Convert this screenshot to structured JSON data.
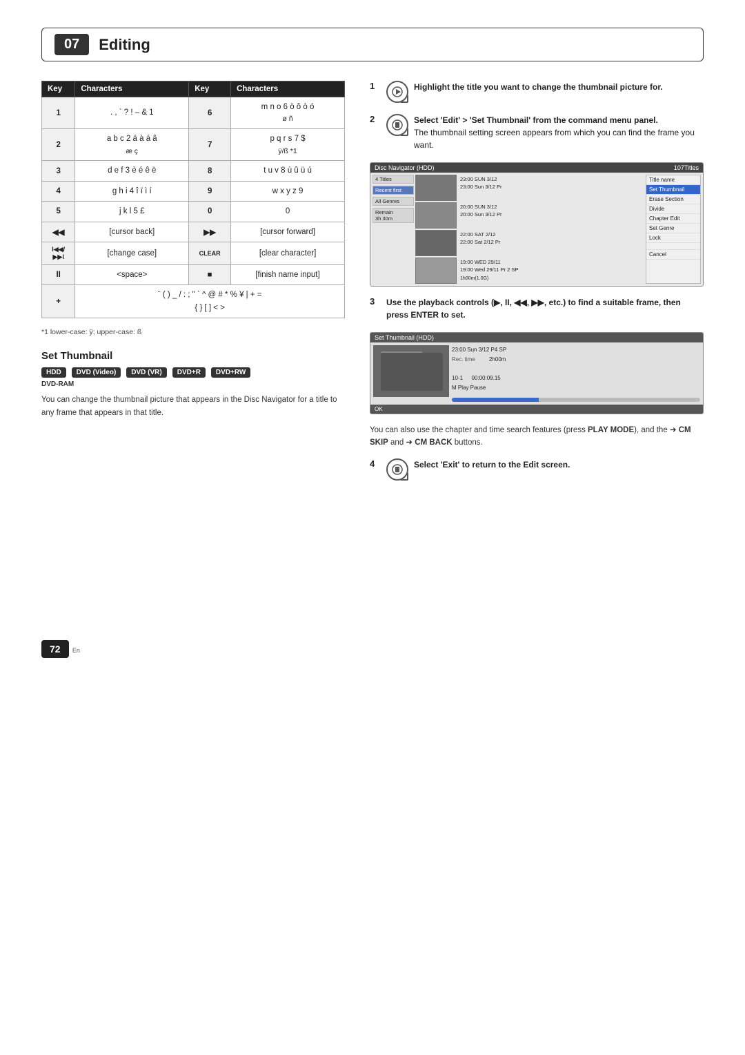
{
  "chapter": {
    "number": "07",
    "title": "Editing"
  },
  "char_table": {
    "headers": [
      "Key",
      "Characters",
      "Key",
      "Characters"
    ],
    "rows": [
      {
        "key1": "1",
        "chars1": ".,`?!–&1",
        "key2": "6",
        "chars2": "m n o 6 ö ô ò ó\nø ñ"
      },
      {
        "key1": "2",
        "chars1": "a b c 2 ä à á â\næ ç",
        "key2": "7",
        "chars2": "p q r s 7 $\nÿ/ß *1"
      },
      {
        "key1": "3",
        "chars1": "d e f 3 è é ê ë",
        "key2": "8",
        "chars2": "t u v 8 ù û ü ú"
      },
      {
        "key1": "4",
        "chars1": "g h i 4 î ï ì í",
        "key2": "9",
        "chars2": "w x y z 9"
      },
      {
        "key1": "5",
        "chars1": "j k l 5 £",
        "key2": "0",
        "chars2": "0"
      },
      {
        "key1": "◀◀",
        "chars1": "[cursor back]",
        "key2": "▶▶",
        "chars2": "[cursor forward]"
      },
      {
        "key1": "I◀◀/\n▶▶I",
        "chars1": "[change case]",
        "key2": "CLEAR",
        "chars2": "[clear character]"
      },
      {
        "key1": "II",
        "chars1": "<space>",
        "key2": "■",
        "chars2": "[finish name input]"
      },
      {
        "key1": "+",
        "chars1": "¨ ( ) _ / : ; \" ` ^ @ # * % ¥ | + =\n{ } [ ] < >",
        "key2": "",
        "chars2": ""
      }
    ]
  },
  "footnote": "*1  lower-case: ÿ; upper-case: ß",
  "set_thumbnail": {
    "title": "Set Thumbnail",
    "formats_hdd": "HDD",
    "formats_dvd_video": "DVD (Video)",
    "formats_dvd_vr": "DVD (VR)",
    "formats_dvdplus_r": "DVD+R",
    "formats_dvdplus_rw": "DVD+RW",
    "formats_dvd_ram": "DVD-RAM",
    "body_text": "You can change the thumbnail picture that appears in the Disc Navigator for a title to any frame that appears in that title."
  },
  "steps": {
    "step1": {
      "number": "1",
      "text_bold": "Highlight the title you want to change the thumbnail picture for."
    },
    "step2": {
      "number": "2",
      "text_bold": "Select 'Edit' > 'Set Thumbnail' from the command menu panel.",
      "subtext": "The thumbnail setting screen appears from which you can find the frame you want."
    },
    "step3": {
      "number": "3",
      "text_bold": "Use the playback controls (▶, II, ◀◀, ▶▶, etc.) to find a suitable frame, then press ENTER to set."
    },
    "step3_subtext": "You can also use the chapter and time search features (press PLAY MODE), and the ➜ CM SKIP and ➜ CM BACK buttons.",
    "step4": {
      "number": "4",
      "text_bold": "Select 'Exit' to return to the Edit screen."
    }
  },
  "nav_screen": {
    "title": "Disc Navigator (HDD)",
    "title_count": "107Titles",
    "sidebar_items": [
      "4 Titles",
      "Recent first",
      "All Genres",
      "Remain\n3h 30m"
    ],
    "rows": [
      {
        "time": "23:00 SUN 3/12",
        "time2": "23:00 Sun 3/12 Pr",
        "label": ""
      },
      {
        "time": "20:00 SUN 3/12",
        "time2": "20:00 Sun 3/12 Pr",
        "label": ""
      },
      {
        "time": "22:00 SAT 2/12",
        "time2": "22:00 Sat 2/12 Pr",
        "label": ""
      },
      {
        "time": "19:00 WED 29/11",
        "time2": "19:00 Wed 29/11 Pr 2 SP",
        "extra": "1h00m(1.0G)"
      }
    ],
    "menu_items": [
      "Title name",
      "Set Thumbnail",
      "Erase Section",
      "Divide",
      "Chapter Edit",
      "Set Genre",
      "Lock",
      "",
      "Cancel"
    ]
  },
  "thumb_screen": {
    "title": "Set Thumbnail (HDD)",
    "date": "23:00 Sun 3/12 P4  SP",
    "rec_time_label": "Rec. time",
    "rec_time_value": "2h00m",
    "chapter_id": "10-1",
    "timecode": "00:00:09.15",
    "mode": "M Play Pause",
    "ok_label": "OK"
  },
  "page": {
    "number": "72",
    "lang": "En"
  }
}
